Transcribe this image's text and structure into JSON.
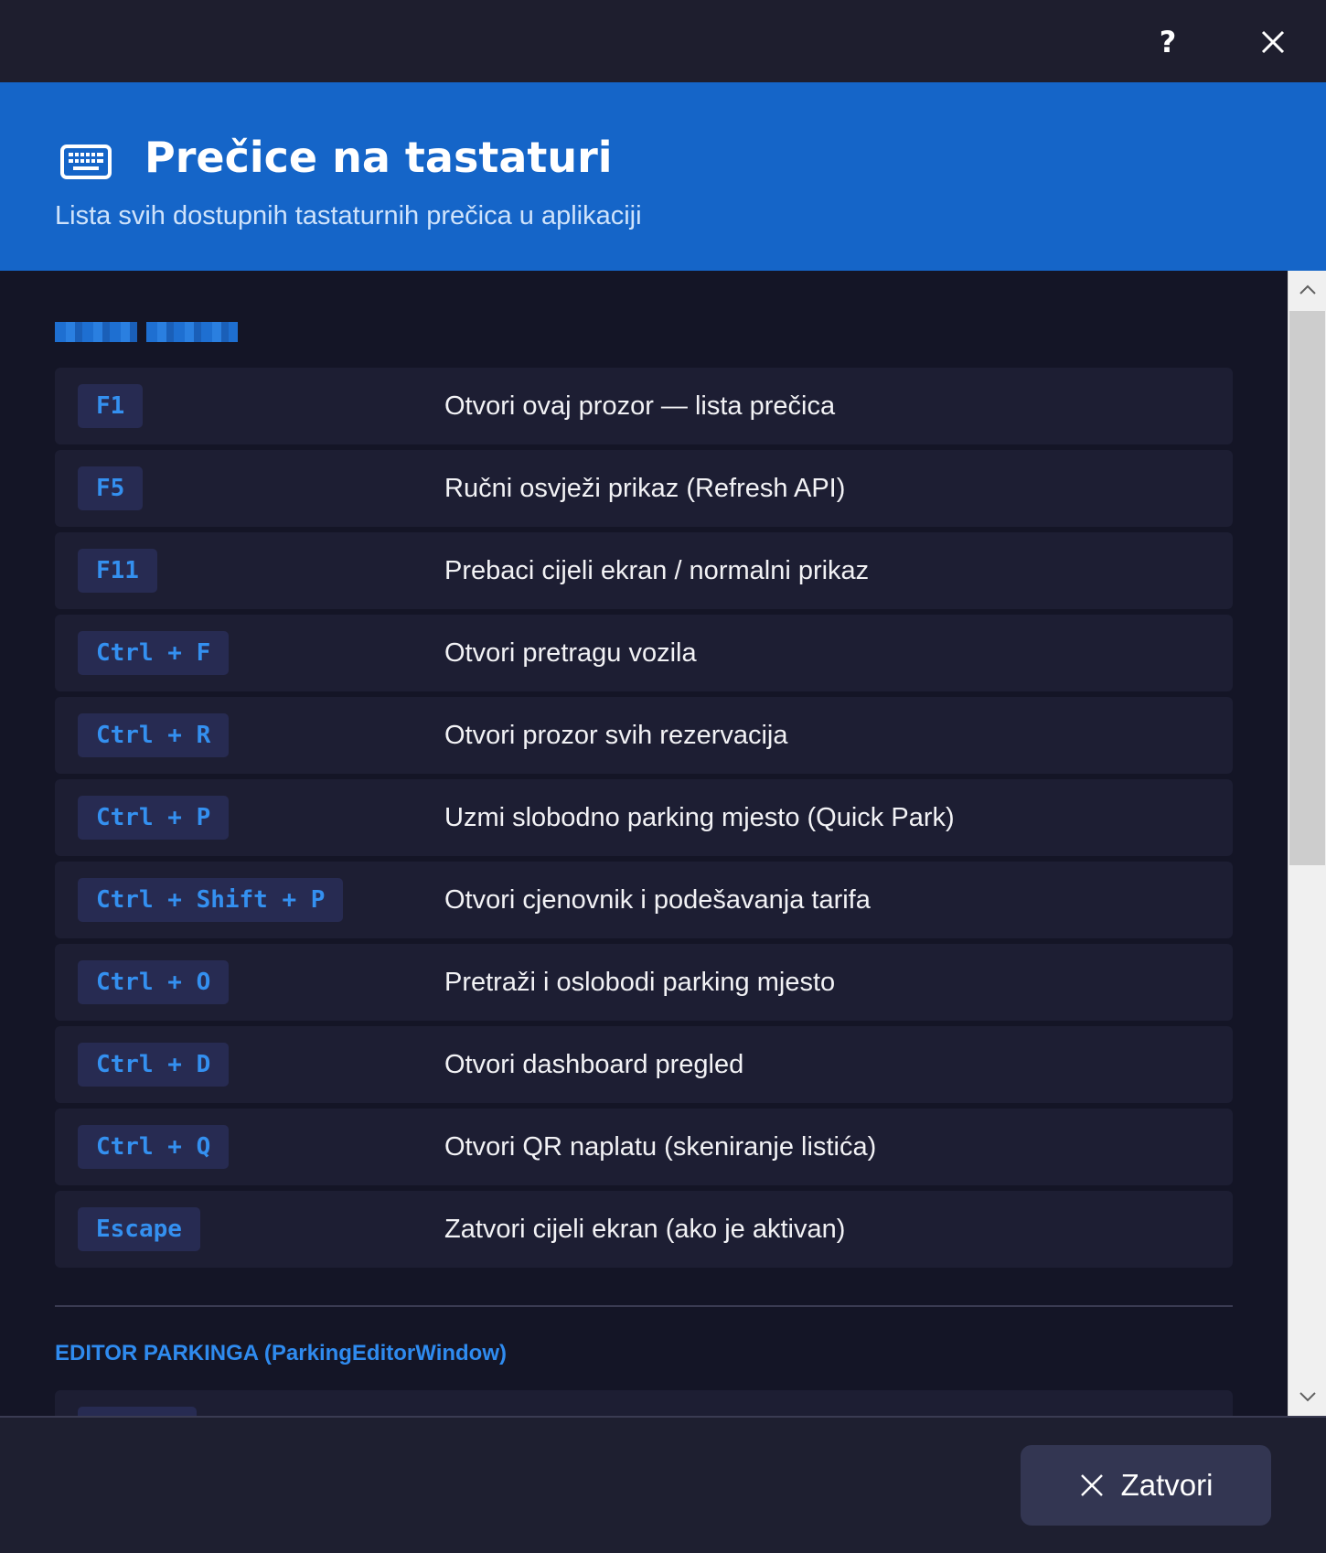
{
  "titlebar": {
    "help_label": "?",
    "close_icon": "close-icon"
  },
  "header": {
    "icon": "keyboard-icon",
    "title": "Prečice na tastaturi",
    "subtitle": "Lista svih dostupnih tastaturnih prečica u aplikaciji"
  },
  "sections": [
    {
      "title_redacted": true,
      "shortcuts": [
        {
          "keys": "F1",
          "description": "Otvori ovaj prozor — lista prečica"
        },
        {
          "keys": "F5",
          "description": "Ručni osvježi prikaz (Refresh API)"
        },
        {
          "keys": "F11",
          "description": "Prebaci cijeli ekran / normalni prikaz"
        },
        {
          "keys": "Ctrl + F",
          "description": "Otvori pretragu vozila"
        },
        {
          "keys": "Ctrl + R",
          "description": "Otvori prozor svih rezervacija"
        },
        {
          "keys": "Ctrl + P",
          "description": "Uzmi slobodno parking mjesto (Quick Park)"
        },
        {
          "keys": "Ctrl + Shift + P",
          "description": "Otvori cjenovnik i podešavanja tarifa"
        },
        {
          "keys": "Ctrl + O",
          "description": "Pretraži i oslobodi parking mjesto"
        },
        {
          "keys": "Ctrl + D",
          "description": "Otvori dashboard pregled"
        },
        {
          "keys": "Ctrl + Q",
          "description": "Otvori QR naplatu (skeniranje listića)"
        },
        {
          "keys": "Escape",
          "description": "Zatvori cijeli ekran (ako je aktivan)"
        }
      ]
    },
    {
      "title": "EDITOR PARKINGA (ParkingEditorWindow)"
    }
  ],
  "footer": {
    "close_label": "Zatvori",
    "close_icon": "close-icon"
  },
  "colors": {
    "accent": "#1565c8",
    "key_text": "#3490f0",
    "background": "#141526"
  }
}
